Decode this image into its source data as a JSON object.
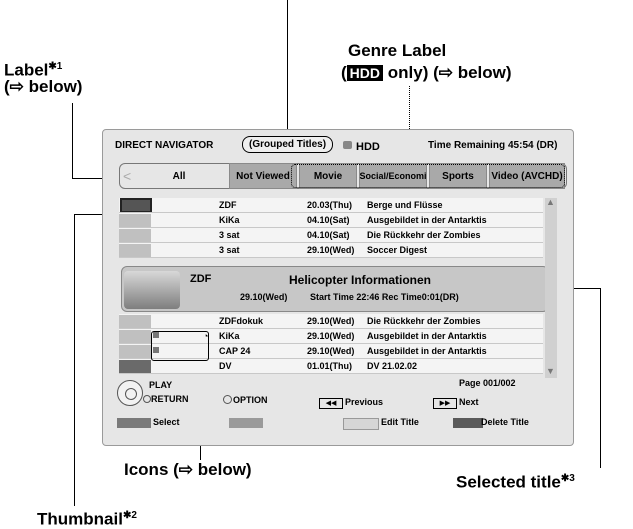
{
  "annotations": {
    "label": "Label",
    "label_mark": "✱1",
    "label_ref": "(⇨ below)",
    "genre_label": "Genre Label",
    "genre_hdd": "HDD",
    "genre_only": "only) (⇨ below)",
    "icons": "Icons (⇨ below)",
    "selected_title": "Selected title",
    "selected_mark": "✱3",
    "thumbnail": "Thumbnail",
    "thumbnail_mark": "✱2"
  },
  "header": {
    "title": "DIRECT NAVIGATOR",
    "grouped": "(Grouped Titles)",
    "drive": "HDD",
    "time_label": "Time Remaining",
    "time_value": "45:54 (DR)"
  },
  "tabs": [
    "All",
    "Not Viewed",
    "Movie",
    "Social/Economi",
    "Sports",
    "Video (AVCHD)"
  ],
  "rows_top": [
    {
      "channel": "ZDF",
      "date": "20.03(Thu)",
      "title": "Berge und Flüsse"
    },
    {
      "channel": "KiKa",
      "date": "04.10(Sat)",
      "title": "Ausgebildet in der Antarktis"
    },
    {
      "channel": "3 sat",
      "date": "04.10(Sat)",
      "title": "Die Rückkehr der Zombies"
    },
    {
      "channel": "3 sat",
      "date": "29.10(Wed)",
      "title": "Soccer Digest"
    }
  ],
  "selected": {
    "channel": "ZDF",
    "title": "Helicopter Informationen",
    "date": "29.10(Wed)",
    "details": "Start Time 22:46 Rec Time0:01(DR)"
  },
  "rows_bottom": [
    {
      "channel": "ZDFdokuk",
      "date": "29.10(Wed)",
      "title": "Die Rückkehr der Zombies"
    },
    {
      "channel": "KiKa",
      "date": "29.10(Wed)",
      "title": "Ausgebildet in der Antarktis"
    },
    {
      "channel": "CAP 24",
      "date": "29.10(Wed)",
      "title": "Ausgebildet in der Antarktis"
    },
    {
      "channel": "DV",
      "date": "01.01(Thu)",
      "title": "DV 21.02.02"
    }
  ],
  "controls": {
    "play": "PLAY",
    "return": "RETURN",
    "option": "OPTION",
    "page": "Page 001/002",
    "previous": "Previous",
    "next": "Next",
    "select": "Select",
    "edit_title": "Edit Title",
    "delete_title": "Delete Title"
  },
  "colors": {
    "red": "#7a7a7a",
    "green": "#9a9a9a",
    "yellow": "#d6d6d6",
    "blue": "#5a5a5a"
  }
}
